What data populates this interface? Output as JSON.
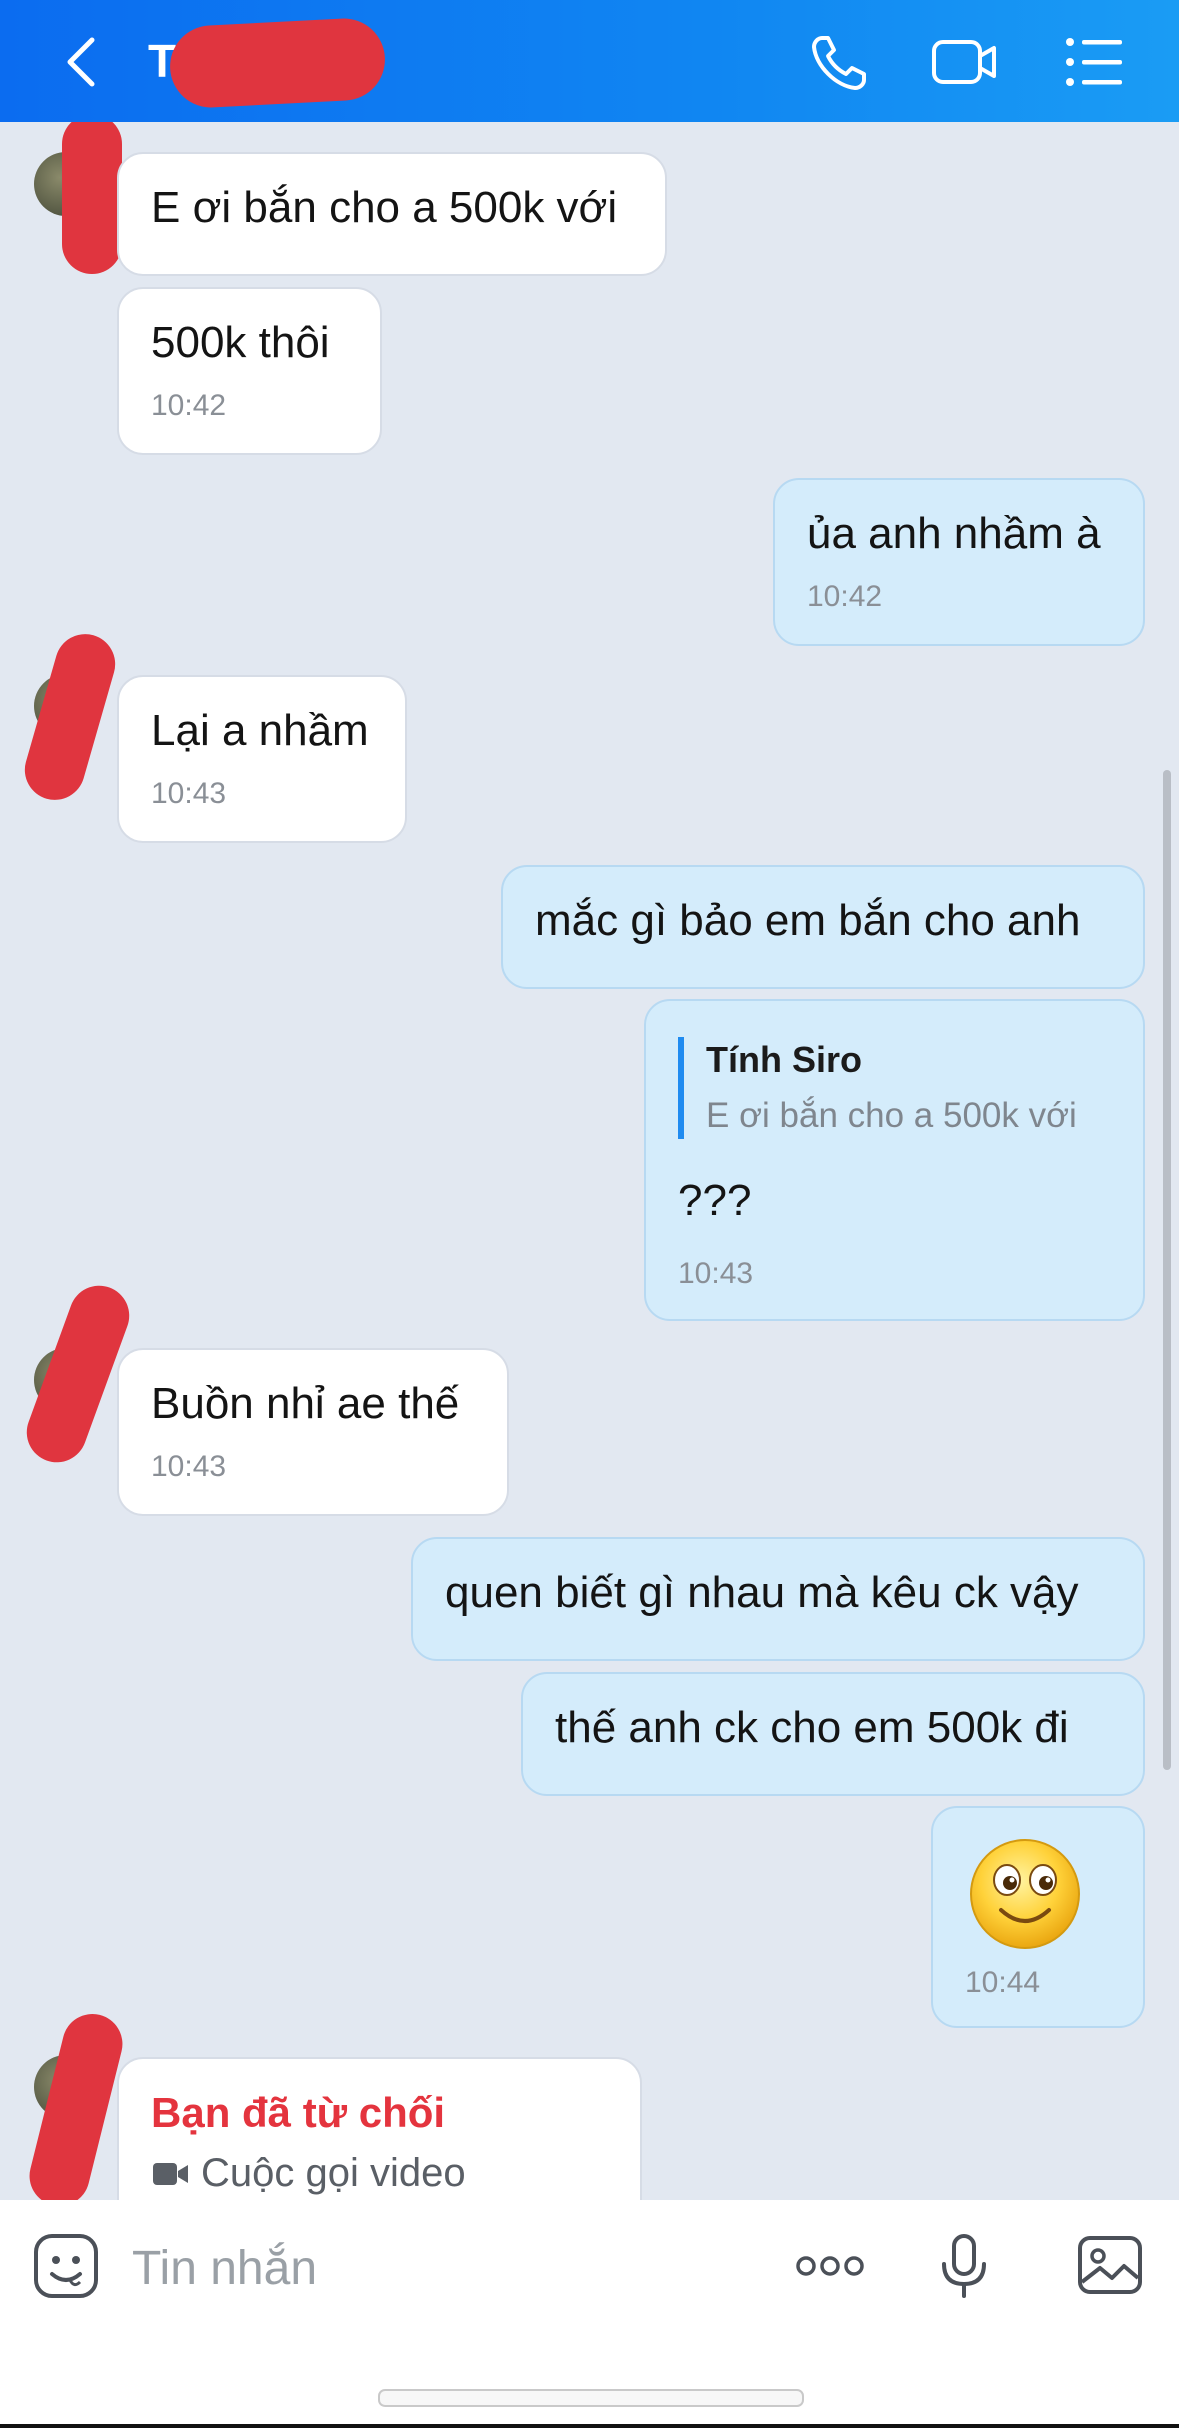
{
  "header": {
    "title_initial": "T",
    "colors": {
      "gradient_start": "#0b6cf0",
      "gradient_end": "#1a9cf4"
    },
    "icons": [
      "back-icon",
      "phone-icon",
      "video-call-icon",
      "menu-icon"
    ]
  },
  "messages": [
    {
      "dir": "in",
      "text": "E ơi bắn cho a 500k với"
    },
    {
      "dir": "in",
      "text": "500k thôi",
      "time": "10:42"
    },
    {
      "dir": "out",
      "text": "ủa anh nhầm à",
      "time": "10:42"
    },
    {
      "dir": "in",
      "text": "Lại a nhầm",
      "time": "10:43"
    },
    {
      "dir": "out",
      "text": "mắc gì bảo em bắn cho anh"
    },
    {
      "dir": "out",
      "quote": {
        "name": "Tính Siro",
        "text": "E ơi bắn cho a 500k với"
      },
      "text": "???",
      "time": "10:43"
    },
    {
      "dir": "in",
      "text": "Buồn nhỉ ae thế",
      "time": "10:43"
    },
    {
      "dir": "out",
      "text": "quen biết gì nhau mà kêu ck vậy"
    },
    {
      "dir": "out",
      "text": "thế anh ck cho em 500k đi"
    },
    {
      "dir": "out",
      "sticker": "smiley-emoji",
      "time": "10:44"
    },
    {
      "dir": "in",
      "call": {
        "title": "Bạn đã từ chối",
        "label": "Cuộc gọi video"
      }
    }
  ],
  "input": {
    "placeholder": "Tin nhắn"
  },
  "colors": {
    "incoming_bubble": "#ffffff",
    "outgoing_bubble": "#d4ecfb",
    "rejected_call": "#e4343e",
    "redaction": "#e0353f"
  }
}
